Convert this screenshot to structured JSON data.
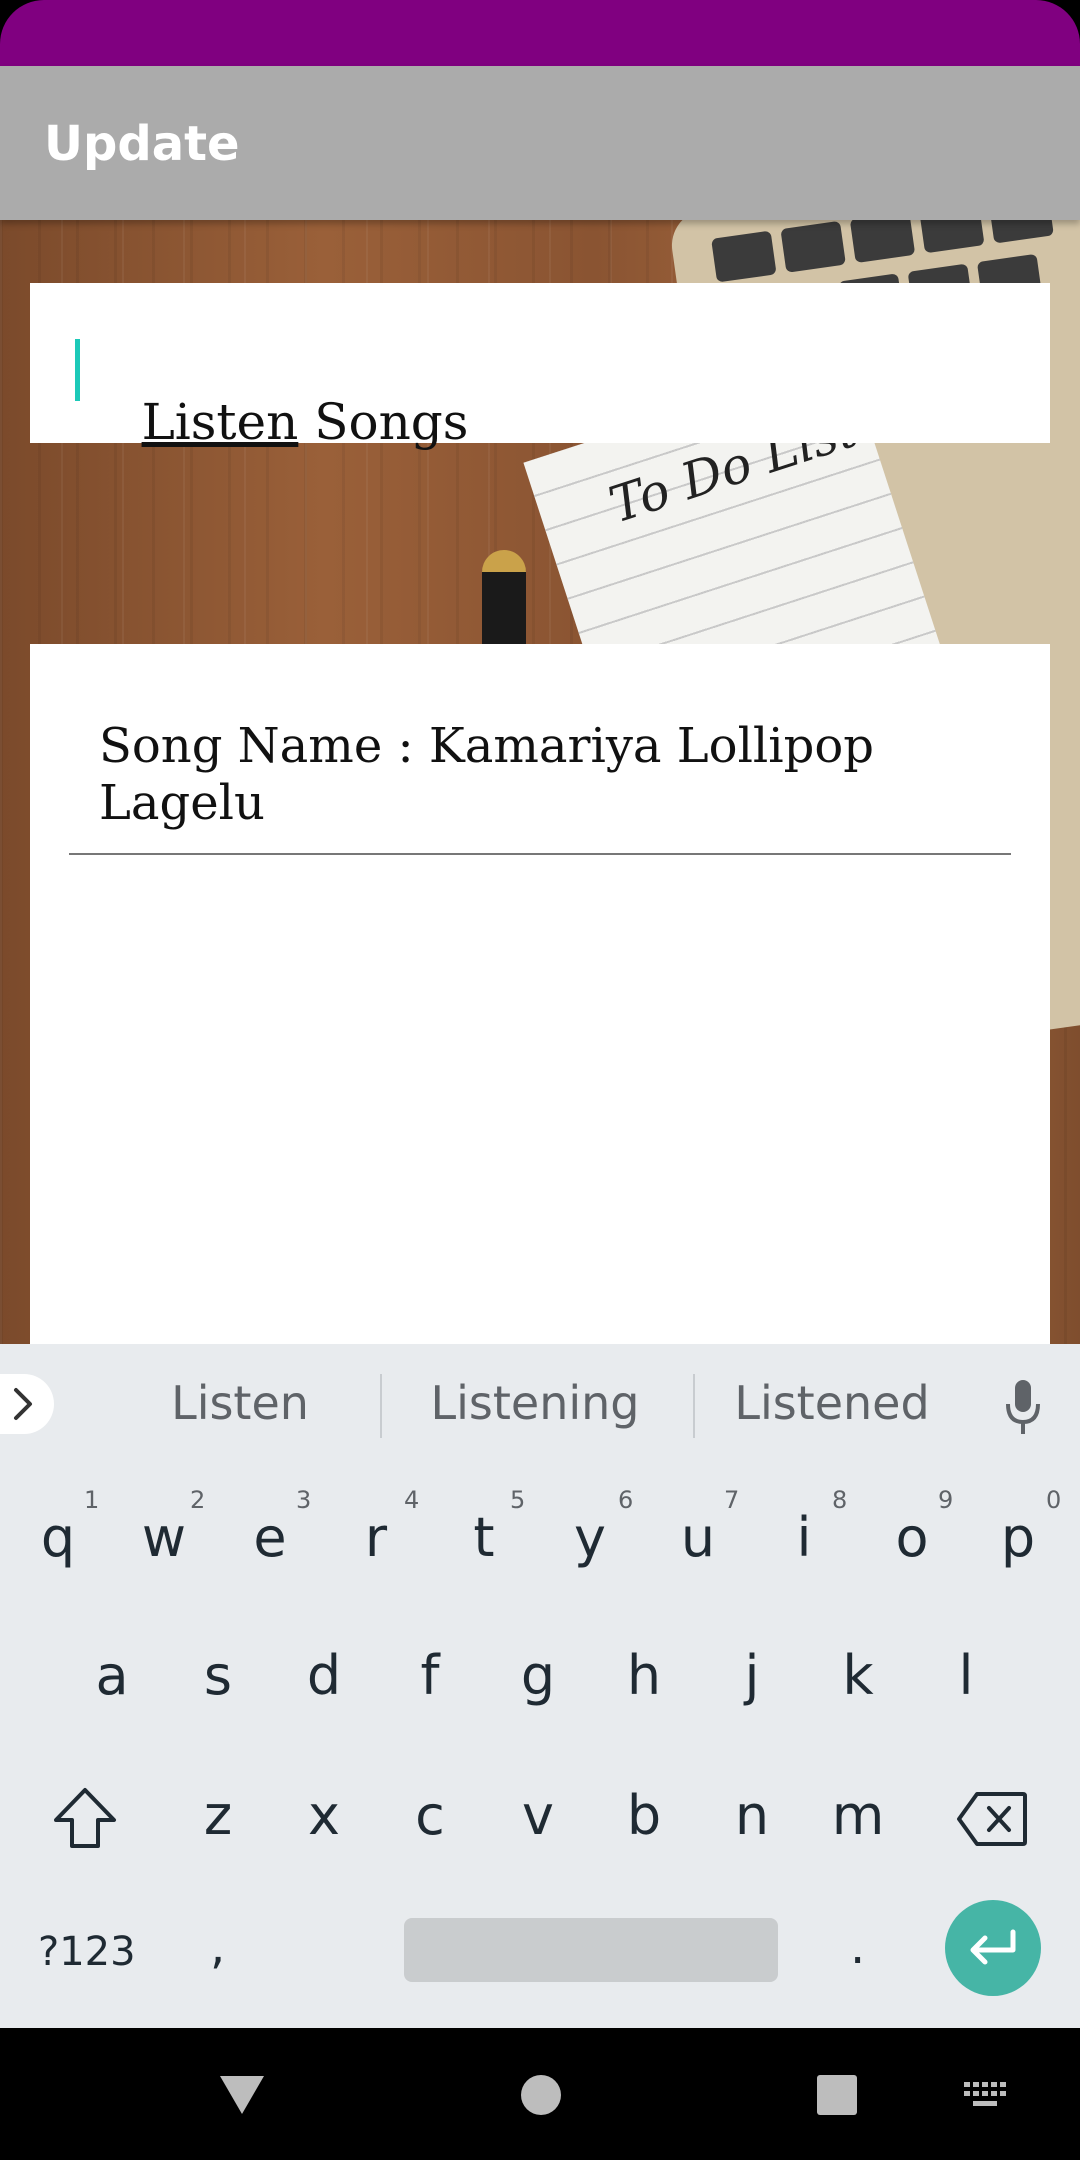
{
  "colors": {
    "status_bar": "#800080",
    "app_bar": "#ababab",
    "accent": "#46b5a6",
    "cursor": "#1cc9b8"
  },
  "app_bar": {
    "title": "Update"
  },
  "background": {
    "notepad_text": "To Do List"
  },
  "task_field": {
    "value_first_word": "Listen",
    "value_rest": " Songs"
  },
  "detail": {
    "song_label": "Song Name : Kamariya Lollipop Lagelu"
  },
  "keyboard": {
    "suggestions": [
      "Listen",
      "Listening",
      "Listened"
    ],
    "row1": [
      "q",
      "w",
      "e",
      "r",
      "t",
      "y",
      "u",
      "i",
      "o",
      "p"
    ],
    "row1_hints": [
      "1",
      "2",
      "3",
      "4",
      "5",
      "6",
      "7",
      "8",
      "9",
      "0"
    ],
    "row2": [
      "a",
      "s",
      "d",
      "f",
      "g",
      "h",
      "j",
      "k",
      "l"
    ],
    "row3": [
      "z",
      "x",
      "c",
      "v",
      "b",
      "n",
      "m"
    ],
    "symbols_label": "?123",
    "comma": ",",
    "period": "."
  },
  "icons": {
    "expand": "chevron-right-icon",
    "mic": "mic-icon",
    "shift": "shift-icon",
    "backspace": "backspace-icon",
    "enter": "enter-icon",
    "nav_back": "triangle-back-icon",
    "nav_home": "circle-home-icon",
    "nav_recents": "square-recents-icon",
    "nav_keyboard": "keyboard-icon"
  }
}
